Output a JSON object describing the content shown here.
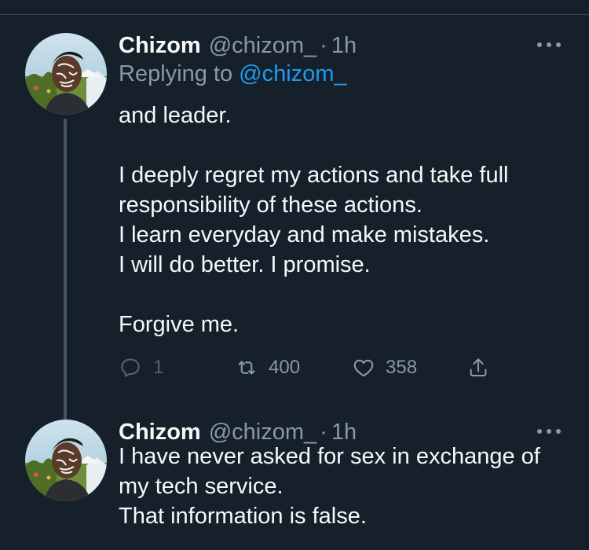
{
  "tweets": [
    {
      "author_name": "Chizom",
      "author_handle": "@chizom_",
      "separator": "·",
      "time": "1h",
      "replying_prefix": "Replying to ",
      "replying_to": "@chizom_",
      "lines": [
        "and leader.",
        "",
        "I deeply regret my actions and take full",
        "responsibility of these actions.",
        "I learn everyday and make mistakes.",
        "I will do better. I promise.",
        "",
        "Forgive me."
      ],
      "reply_count": "1",
      "retweet_count": "400",
      "like_count": "358"
    },
    {
      "author_name": "Chizom",
      "author_handle": "@chizom_",
      "separator": "·",
      "time": "1h",
      "lines": [
        "I have never asked for sex in exchange of",
        "my tech service.",
        "That information is false."
      ]
    }
  ],
  "icons": {
    "reply": "reply-icon",
    "retweet": "retweet-icon",
    "like": "heart-icon",
    "share": "share-icon",
    "more": "more-icon"
  },
  "colors": {
    "background": "#15202b",
    "text": "#f7f9f9",
    "muted": "#8b98a5",
    "link": "#1d9bf0",
    "thread_line": "#425466"
  }
}
